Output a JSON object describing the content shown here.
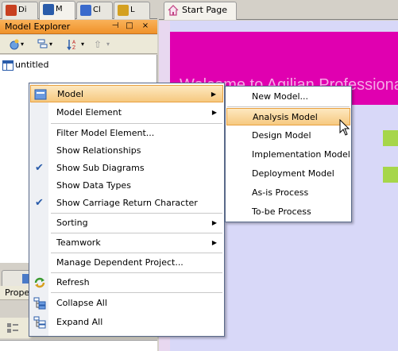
{
  "left_tabs": [
    {
      "label": "Di",
      "icon": "diagram-navigator-icon",
      "color": "#c84020"
    },
    {
      "label": "M",
      "icon": "model-explorer-icon",
      "color": "#2a5caa"
    },
    {
      "label": "Cl",
      "icon": "class-repository-icon",
      "color": "#3a6acc"
    },
    {
      "label": "L",
      "icon": "logical-view-icon",
      "color": "#d4a020"
    }
  ],
  "model_explorer": {
    "title": "Model Explorer",
    "tree": [
      {
        "label": "untitled",
        "icon": "project-icon"
      }
    ]
  },
  "properties": {
    "title": "Prope"
  },
  "editor": {
    "tab_label": "Start Page",
    "welcome_text": "Welcome to Agilian Professional"
  },
  "context_menu": {
    "items": [
      {
        "label": "Model",
        "icon": "model-icon",
        "submenu": true,
        "highlighted": true
      },
      {
        "label": "Model Element",
        "submenu": true
      },
      {
        "label": "Filter Model Element..."
      },
      {
        "label": "Show Relationships"
      },
      {
        "label": "Show Sub Diagrams",
        "checked": true
      },
      {
        "label": "Show Data Types"
      },
      {
        "label": "Show Carriage Return Character",
        "checked": true
      },
      {
        "label": "Sorting",
        "submenu": true
      },
      {
        "label": "Teamwork",
        "submenu": true
      },
      {
        "label": "Manage Dependent Project..."
      },
      {
        "label": "Refresh",
        "icon": "refresh-icon"
      },
      {
        "label": "Collapse All",
        "icon": "collapse-all-icon"
      },
      {
        "label": "Expand All",
        "icon": "expand-all-icon"
      }
    ]
  },
  "submenu": {
    "items": [
      {
        "label": "New Model..."
      },
      {
        "label": "Analysis Model",
        "highlighted": true
      },
      {
        "label": "Design Model"
      },
      {
        "label": "Implementation Model"
      },
      {
        "label": "Deployment Model"
      },
      {
        "label": "As-is Process"
      },
      {
        "label": "To-be Process"
      }
    ]
  },
  "colors": {
    "header_orange": "#f0922a",
    "highlight": "#f6c980",
    "banner_magenta": "#e000b0",
    "accent_green": "#a6d64a"
  }
}
